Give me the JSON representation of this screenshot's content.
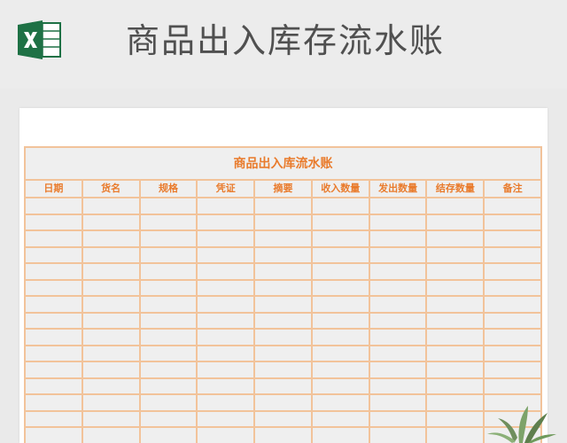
{
  "header": {
    "title": "商品出入库存流水账"
  },
  "sheet": {
    "title": "商品出入库流水账",
    "columns": [
      "日期",
      "货名",
      "规格",
      "凭证",
      "摘要",
      "收入数量",
      "发出数量",
      "结存数量",
      "备注"
    ]
  },
  "colors": {
    "accent": "#e97b2c",
    "border": "#f2c39a",
    "excel_green": "#1e7145"
  },
  "icons": {
    "app": "excel-icon",
    "decoration": "plant-icon"
  }
}
